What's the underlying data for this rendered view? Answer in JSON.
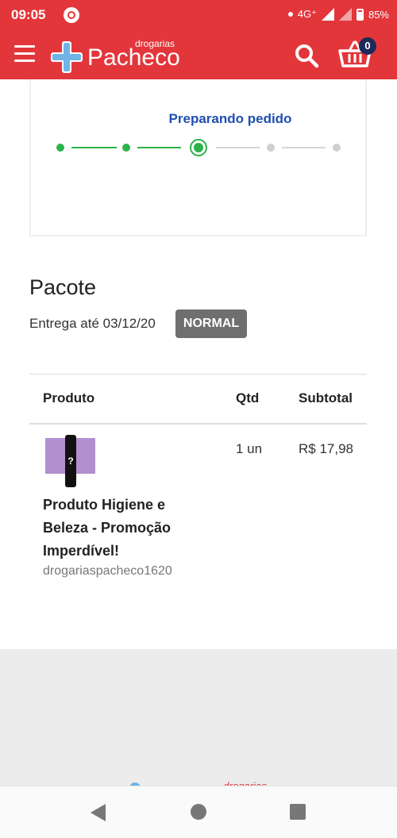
{
  "status_bar": {
    "time": "09:05",
    "network": "4G⁺",
    "battery": "85%"
  },
  "header": {
    "brand_small": "drogarias",
    "brand_big": "Pacheco",
    "cart_count": "0"
  },
  "tracking": {
    "current_status": "Preparando pedido",
    "steps": [
      "done",
      "done",
      "current",
      "pending",
      "pending"
    ],
    "colors": {
      "done": "#2bb34a",
      "pending": "#cfcfcf",
      "status_text": "#1f4fb0"
    }
  },
  "package": {
    "title": "Pacote",
    "delivery": "Entrega até 03/12/20",
    "badge": "NORMAL"
  },
  "table": {
    "headers": {
      "product": "Produto",
      "qty": "Qtd",
      "subtotal": "Subtotal"
    },
    "rows": [
      {
        "name": "Produto Higiene e Beleza - Promoção Imperdível!",
        "seller": "drogariaspacheco1620",
        "qty": "1 un",
        "subtotal": "R$ 17,98",
        "thumb_glyph": "?"
      }
    ]
  },
  "footer": {
    "brand_fragment": "drogarias"
  },
  "colors": {
    "brand_red": "#e3363b",
    "badge_gray": "#6f6f6f"
  }
}
